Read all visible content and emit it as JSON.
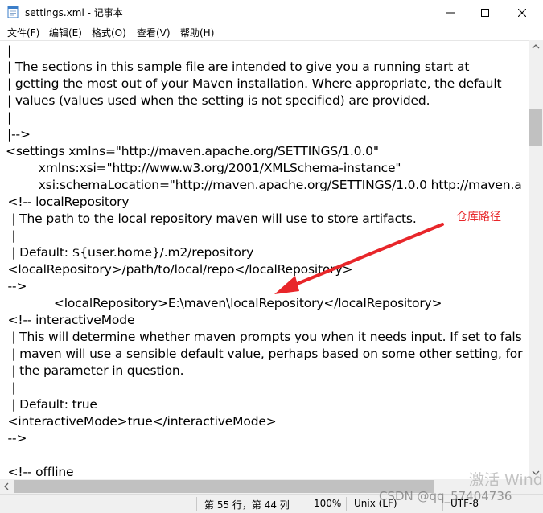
{
  "titlebar": {
    "title": "settings.xml - 记事本",
    "icon": "notepad-icon",
    "minimize_icon": "minimize-icon",
    "maximize_icon": "maximize-icon",
    "close_icon": "close-icon"
  },
  "menu": {
    "items": [
      "文件(F)",
      "编辑(E)",
      "格式(O)",
      "查看(V)",
      "帮助(H)"
    ]
  },
  "editor": {
    "lines": [
      "|",
      "| The sections in this sample file are intended to give you a running start at",
      "| getting the most out of your Maven installation. Where appropriate, the default",
      "| values (values used when the setting is not specified) are provided.",
      "|",
      "|-->",
      "<settings xmlns=\"http://maven.apache.org/SETTINGS/1.0.0\"",
      "          xmlns:xsi=\"http://www.w3.org/2001/XMLSchema-instance\"",
      "          xsi:schemaLocation=\"http://maven.apache.org/SETTINGS/1.0.0 http://maven.a",
      "  <!-- localRepository",
      "   | The path to the local repository maven will use to store artifacts.",
      "   |",
      "   | Default: ${user.home}/.m2/repository",
      "  <localRepository>/path/to/local/repo</localRepository>",
      "  -->",
      "              <localRepository>E:\\maven\\localRepository</localRepository>",
      "  <!-- interactiveMode",
      "   | This will determine whether maven prompts you when it needs input. If set to fals",
      "   | maven will use a sensible default value, perhaps based on some other setting, for",
      "   | the parameter in question.",
      "   |",
      "   | Default: true",
      "  <interactiveMode>true</interactiveMode>",
      "  -->",
      "",
      "  <!-- offline"
    ]
  },
  "annotation": {
    "label": "仓库路径",
    "color": "#e8262a"
  },
  "statusbar": {
    "position": "第 55 行，第 44 列",
    "zoom": "100%",
    "line_ending": "Unix (LF)",
    "encoding": "UTF-8"
  },
  "watermarks": {
    "activate": "激活 Wind",
    "csdn": "CSDN @qq_57404736"
  }
}
